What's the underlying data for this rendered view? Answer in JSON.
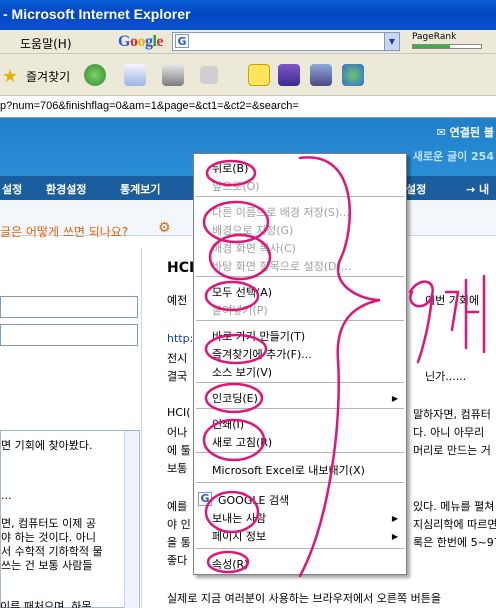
{
  "window": {
    "title": "- Microsoft Internet Explorer"
  },
  "menubar": {
    "help": "도움말(H)"
  },
  "google_toolbar": {
    "logo": [
      "G",
      "o",
      "o",
      "g",
      "l",
      "e"
    ],
    "search_icon_letter": "G",
    "pagerank_label": "PageRank",
    "pagerank_level": 0.55,
    "dropdown_arrow": "▼"
  },
  "toolbar": {
    "favorites": "즐겨찾기"
  },
  "address": {
    "url": "p?num=706&finishflag=0&am=1&page=&ct1=&ct2=&search="
  },
  "site": {
    "login": "✉ 연결된 블",
    "new_posts": "새로운 글이 254",
    "nav": [
      "설정",
      "환경설정",
      "통계보기",
      "설정",
      "→ 내"
    ],
    "question": "글은 어떻게 쓰면 되나요?",
    "gear_icon": "⚙"
  },
  "left": {
    "lines": [
      "면 기회에 찾아봤다.",
      "...",
      "면, 컴퓨터도 이제 공",
      "야 하는 것이다. 아니",
      "서 수학적 기하학적 물",
      "쓰는 건 보통 사람들"
    ],
    "bottom": "이루 패처으며, 하목"
  },
  "article": {
    "title": "HCI",
    "lines": [
      "예전",
      "http:",
      "전시",
      "결국",
      "HCI(",
      "어나",
      "에 툴",
      "보통",
      "예를",
      "야 인",
      "을 통",
      "좋다",
      "실제로 지금 여러분이 사용하는 브라우저에서 오른쪽 버튼을"
    ],
    "right_fragments": [
      "이번 기회에",
      "닌가......",
      "말하자면, 컴퓨터",
      "다. 아니 아무리",
      "머리로 만드는 거",
      "있다. 메뉴를 펼쳐",
      "지심리학에 따르면",
      "록은 한번에 5~97"
    ]
  },
  "context_menu": {
    "items": [
      {
        "label": "뒤로(B)",
        "enabled": true
      },
      {
        "label": "앞으로(O)",
        "enabled": false
      },
      {
        "label": "다른 이름으로 배경 저장(S)...",
        "enabled": false
      },
      {
        "label": "배경으로 지정(G)",
        "enabled": false
      },
      {
        "label": "배경 화면 복사(C)",
        "enabled": false
      },
      {
        "label": "바탕 화면 항목으로 설정(D)...",
        "enabled": false
      },
      {
        "label": "모두 선택(A)",
        "enabled": true
      },
      {
        "label": "붙여넣기(P)",
        "enabled": false
      },
      {
        "label": "바로 가기 만들기(T)",
        "enabled": true
      },
      {
        "label": "즐겨찾기에 추가(F)...",
        "enabled": true
      },
      {
        "label": "소스 보기(V)",
        "enabled": true
      },
      {
        "label": "인코딩(E)",
        "enabled": true,
        "submenu": true
      },
      {
        "label": "인쇄(I)",
        "enabled": true
      },
      {
        "label": "새로 고침(R)",
        "enabled": true
      },
      {
        "label": "Microsoft Excel로 내보내기(X)",
        "enabled": true
      },
      {
        "label": "GOOGLE 검색",
        "enabled": true
      },
      {
        "label": "보내는 사람",
        "enabled": true,
        "submenu": true
      },
      {
        "label": "페이지 정보",
        "enabled": true,
        "submenu": true
      },
      {
        "label": "속성(R)",
        "enabled": true
      }
    ],
    "submenu_arrow": "▶"
  },
  "annotation": {
    "text": "9개",
    "color": "#e0157a"
  }
}
